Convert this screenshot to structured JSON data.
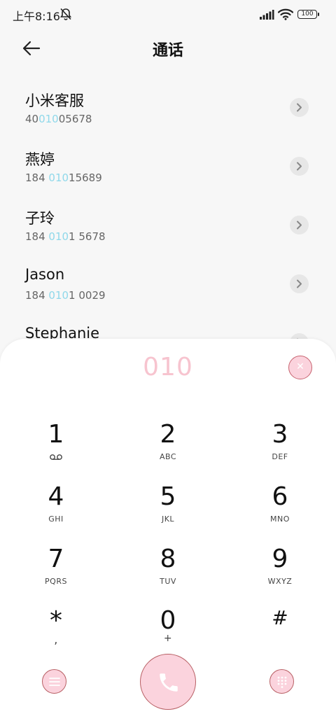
{
  "status_bar": {
    "time": "上午8:16",
    "battery": "100",
    "icons": [
      "bell-muted-icon",
      "cell-signal-icon",
      "wifi-icon",
      "battery-icon"
    ]
  },
  "header": {
    "title": "通话",
    "back_icon": "arrow-left-icon"
  },
  "contacts": [
    {
      "name": "小米客服",
      "number_pre": "40",
      "number_hl": "010",
      "number_post": "05678"
    },
    {
      "name": "燕婷",
      "number_pre": "184 ",
      "number_hl": "010",
      "number_post": "15689"
    },
    {
      "name": "子玲",
      "number_pre": "184 ",
      "number_hl": "010",
      "number_post": "1 5678"
    },
    {
      "name": "Jason",
      "number_pre": "184 ",
      "number_hl": "010",
      "number_post": "1 0029"
    },
    {
      "name": "Stephanie",
      "number_pre": "",
      "number_hl": "",
      "number_post": ""
    }
  ],
  "dialpad": {
    "dialed": "010",
    "clear_icon": "close-icon",
    "keys": [
      {
        "digit": "1",
        "sub": "",
        "icon": "voicemail-icon"
      },
      {
        "digit": "2",
        "sub": "ABC"
      },
      {
        "digit": "3",
        "sub": "DEF"
      },
      {
        "digit": "4",
        "sub": "GHI"
      },
      {
        "digit": "5",
        "sub": "JKL"
      },
      {
        "digit": "6",
        "sub": "MNO"
      },
      {
        "digit": "7",
        "sub": "PQRS"
      },
      {
        "digit": "8",
        "sub": "TUV"
      },
      {
        "digit": "9",
        "sub": "WXYZ"
      },
      {
        "digit": "*",
        "sub": ","
      },
      {
        "digit": "0",
        "sub": "+"
      },
      {
        "digit": "#",
        "sub": ""
      }
    ],
    "bottom_icons": [
      "menu-icon",
      "phone-icon",
      "dialpad-icon"
    ]
  },
  "colors": {
    "accent_pink": "#fbd3dd",
    "accent_border": "#b85f64",
    "highlight_blue": "#8fd8ea",
    "dialed_text": "#f7c4cf"
  }
}
